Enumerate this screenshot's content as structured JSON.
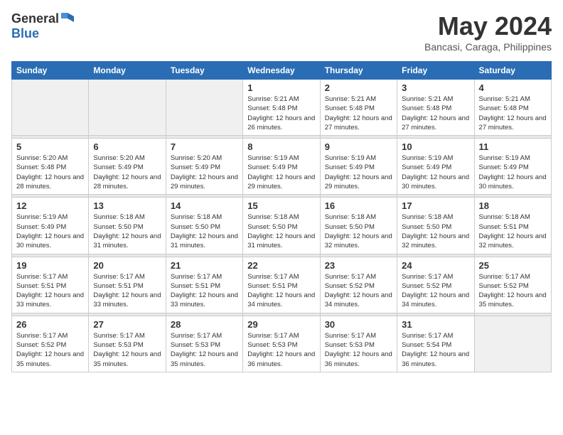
{
  "logo": {
    "general": "General",
    "blue": "Blue"
  },
  "title": "May 2024",
  "subtitle": "Bancasi, Caraga, Philippines",
  "days_of_week": [
    "Sunday",
    "Monday",
    "Tuesday",
    "Wednesday",
    "Thursday",
    "Friday",
    "Saturday"
  ],
  "weeks": [
    {
      "cells": [
        {
          "empty": true
        },
        {
          "empty": true
        },
        {
          "empty": true
        },
        {
          "day": "1",
          "sunrise": "5:21 AM",
          "sunset": "5:48 PM",
          "daylight": "12 hours and 26 minutes."
        },
        {
          "day": "2",
          "sunrise": "5:21 AM",
          "sunset": "5:48 PM",
          "daylight": "12 hours and 27 minutes."
        },
        {
          "day": "3",
          "sunrise": "5:21 AM",
          "sunset": "5:48 PM",
          "daylight": "12 hours and 27 minutes."
        },
        {
          "day": "4",
          "sunrise": "5:21 AM",
          "sunset": "5:48 PM",
          "daylight": "12 hours and 27 minutes."
        }
      ]
    },
    {
      "cells": [
        {
          "day": "5",
          "sunrise": "5:20 AM",
          "sunset": "5:48 PM",
          "daylight": "12 hours and 28 minutes."
        },
        {
          "day": "6",
          "sunrise": "5:20 AM",
          "sunset": "5:49 PM",
          "daylight": "12 hours and 28 minutes."
        },
        {
          "day": "7",
          "sunrise": "5:20 AM",
          "sunset": "5:49 PM",
          "daylight": "12 hours and 29 minutes."
        },
        {
          "day": "8",
          "sunrise": "5:19 AM",
          "sunset": "5:49 PM",
          "daylight": "12 hours and 29 minutes."
        },
        {
          "day": "9",
          "sunrise": "5:19 AM",
          "sunset": "5:49 PM",
          "daylight": "12 hours and 29 minutes."
        },
        {
          "day": "10",
          "sunrise": "5:19 AM",
          "sunset": "5:49 PM",
          "daylight": "12 hours and 30 minutes."
        },
        {
          "day": "11",
          "sunrise": "5:19 AM",
          "sunset": "5:49 PM",
          "daylight": "12 hours and 30 minutes."
        }
      ]
    },
    {
      "cells": [
        {
          "day": "12",
          "sunrise": "5:19 AM",
          "sunset": "5:49 PM",
          "daylight": "12 hours and 30 minutes."
        },
        {
          "day": "13",
          "sunrise": "5:18 AM",
          "sunset": "5:50 PM",
          "daylight": "12 hours and 31 minutes."
        },
        {
          "day": "14",
          "sunrise": "5:18 AM",
          "sunset": "5:50 PM",
          "daylight": "12 hours and 31 minutes."
        },
        {
          "day": "15",
          "sunrise": "5:18 AM",
          "sunset": "5:50 PM",
          "daylight": "12 hours and 31 minutes."
        },
        {
          "day": "16",
          "sunrise": "5:18 AM",
          "sunset": "5:50 PM",
          "daylight": "12 hours and 32 minutes."
        },
        {
          "day": "17",
          "sunrise": "5:18 AM",
          "sunset": "5:50 PM",
          "daylight": "12 hours and 32 minutes."
        },
        {
          "day": "18",
          "sunrise": "5:18 AM",
          "sunset": "5:51 PM",
          "daylight": "12 hours and 32 minutes."
        }
      ]
    },
    {
      "cells": [
        {
          "day": "19",
          "sunrise": "5:17 AM",
          "sunset": "5:51 PM",
          "daylight": "12 hours and 33 minutes."
        },
        {
          "day": "20",
          "sunrise": "5:17 AM",
          "sunset": "5:51 PM",
          "daylight": "12 hours and 33 minutes."
        },
        {
          "day": "21",
          "sunrise": "5:17 AM",
          "sunset": "5:51 PM",
          "daylight": "12 hours and 33 minutes."
        },
        {
          "day": "22",
          "sunrise": "5:17 AM",
          "sunset": "5:51 PM",
          "daylight": "12 hours and 34 minutes."
        },
        {
          "day": "23",
          "sunrise": "5:17 AM",
          "sunset": "5:52 PM",
          "daylight": "12 hours and 34 minutes."
        },
        {
          "day": "24",
          "sunrise": "5:17 AM",
          "sunset": "5:52 PM",
          "daylight": "12 hours and 34 minutes."
        },
        {
          "day": "25",
          "sunrise": "5:17 AM",
          "sunset": "5:52 PM",
          "daylight": "12 hours and 35 minutes."
        }
      ]
    },
    {
      "cells": [
        {
          "day": "26",
          "sunrise": "5:17 AM",
          "sunset": "5:52 PM",
          "daylight": "12 hours and 35 minutes."
        },
        {
          "day": "27",
          "sunrise": "5:17 AM",
          "sunset": "5:53 PM",
          "daylight": "12 hours and 35 minutes."
        },
        {
          "day": "28",
          "sunrise": "5:17 AM",
          "sunset": "5:53 PM",
          "daylight": "12 hours and 35 minutes."
        },
        {
          "day": "29",
          "sunrise": "5:17 AM",
          "sunset": "5:53 PM",
          "daylight": "12 hours and 36 minutes."
        },
        {
          "day": "30",
          "sunrise": "5:17 AM",
          "sunset": "5:53 PM",
          "daylight": "12 hours and 36 minutes."
        },
        {
          "day": "31",
          "sunrise": "5:17 AM",
          "sunset": "5:54 PM",
          "daylight": "12 hours and 36 minutes."
        },
        {
          "empty": true
        }
      ]
    }
  ]
}
